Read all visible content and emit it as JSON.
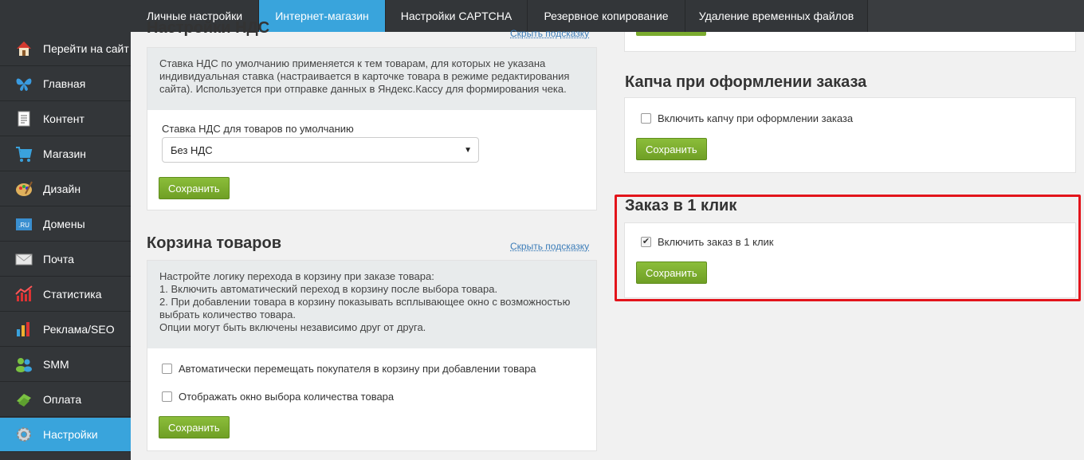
{
  "tabs": [
    {
      "label": "Личные настройки",
      "active": false
    },
    {
      "label": "Интернет-магазин",
      "active": true
    },
    {
      "label": "Настройки CAPTCHA",
      "active": false
    },
    {
      "label": "Резервное копирование",
      "active": false
    },
    {
      "label": "Удаление временных файлов",
      "active": false
    }
  ],
  "sidebar": {
    "items": [
      {
        "label": "Перейти на сайт",
        "icon": "home-icon"
      },
      {
        "label": "Главная",
        "icon": "butterfly-icon"
      },
      {
        "label": "Контент",
        "icon": "document-icon"
      },
      {
        "label": "Магазин",
        "icon": "cart-icon"
      },
      {
        "label": "Дизайн",
        "icon": "palette-icon"
      },
      {
        "label": "Домены",
        "icon": "ru-domain-icon"
      },
      {
        "label": "Почта",
        "icon": "envelope-icon"
      },
      {
        "label": "Статистика",
        "icon": "stats-icon"
      },
      {
        "label": "Реклама/SEO",
        "icon": "bar-chart-icon"
      },
      {
        "label": "SMM",
        "icon": "people-icon"
      },
      {
        "label": "Оплата",
        "icon": "money-icon"
      },
      {
        "label": "Настройки",
        "icon": "gear-icon",
        "active": true
      }
    ]
  },
  "vat": {
    "title": "Настройки НДС",
    "hint": "Скрыть подсказку",
    "description": [
      "Ставка НДС по умолчанию применяется к тем товарам, для которых не указана",
      "индивидуальная ставка (настраивается в карточке товара в режиме редактирования",
      "сайта). Используется при отправке данных в Яндекс.Кассу для формирования чека."
    ],
    "field_label": "Ставка НДС для товаров по умолчанию",
    "selected": "Без НДС",
    "save": "Сохранить"
  },
  "cart": {
    "title": "Корзина товаров",
    "hint": "Скрыть подсказку",
    "description": [
      "Настройте логику перехода в корзину при заказе товара:",
      "1. Включить автоматический переход в корзину после выбора товара.",
      "2. При добавлении товара в корзину показывать всплывающее окно с возможностью",
      "выбрать количество товара.",
      "Опции могут быть включены независимо друг от друга."
    ],
    "option_auto": "Автоматически перемещать покупателя в корзину при добавлении товара",
    "option_auto_checked": false,
    "option_qty": "Отображать окно выбора количества товара",
    "option_qty_checked": false,
    "save": "Сохранить"
  },
  "captcha": {
    "title": "Капча при оформлении заказа",
    "option": "Включить капчу при оформлении заказа",
    "checked": false,
    "save": "Сохранить"
  },
  "oneclick": {
    "title": "Заказ в 1 клик",
    "option": "Включить заказ в 1 клик",
    "checked": true,
    "save": "Сохранить"
  },
  "colors": {
    "accent": "#39a4dc",
    "sidebar": "#333639",
    "button": "#7aab2e",
    "highlight": "#e3141b"
  }
}
